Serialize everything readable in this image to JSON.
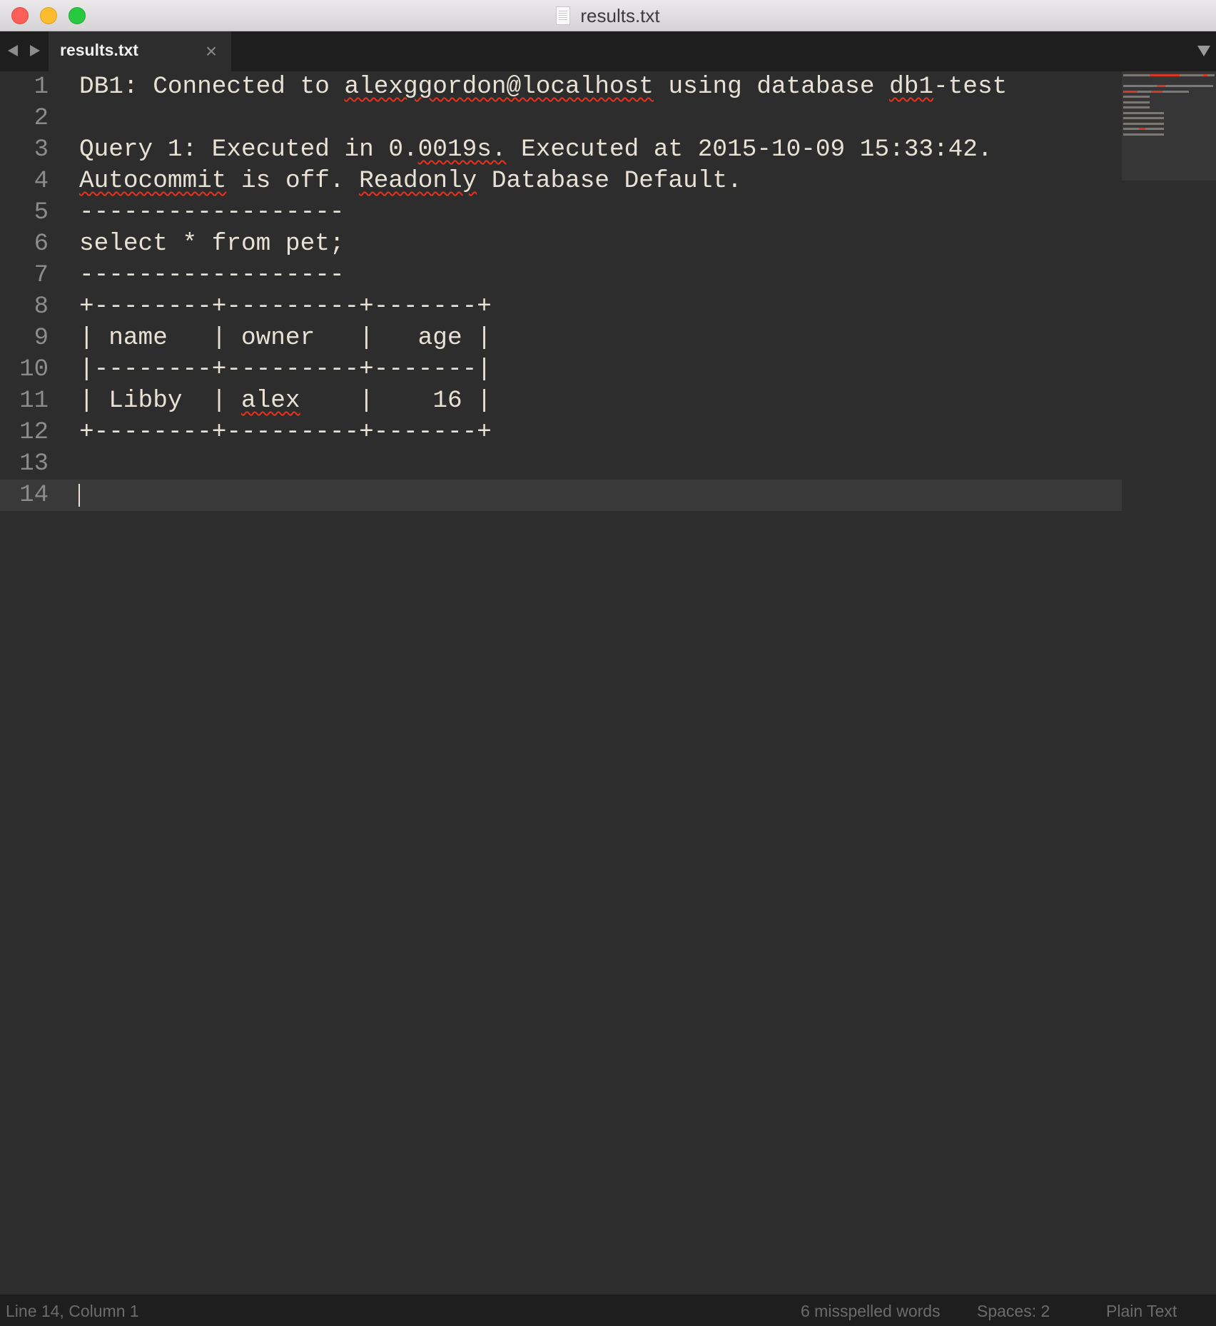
{
  "window": {
    "title": "results.txt",
    "title_icon": "document-icon"
  },
  "tabbar": {
    "back_icon": "triangle-left-icon",
    "forward_icon": "triangle-right-icon",
    "tabs": [
      {
        "label": "results.txt",
        "close_glyph": "×",
        "active": true
      }
    ],
    "dropdown_icon": "triangle-down-icon"
  },
  "editor": {
    "lines": [
      {
        "num": "1",
        "segments": [
          {
            "text": "DB1: Connected to ",
            "misspelled": false
          },
          {
            "text": "alexggordon@localhost",
            "misspelled": true
          },
          {
            "text": " using database ",
            "misspelled": false
          },
          {
            "text": "db1",
            "misspelled": true
          },
          {
            "text": "-test",
            "misspelled": false
          }
        ]
      },
      {
        "num": "2",
        "segments": []
      },
      {
        "num": "3",
        "segments": [
          {
            "text": "Query 1: Executed in 0.",
            "misspelled": false
          },
          {
            "text": "0019s.",
            "misspelled": true
          },
          {
            "text": " Executed at 2015-10-09 15:33:42.",
            "misspelled": false
          }
        ]
      },
      {
        "num": "4",
        "segments": [
          {
            "text": "Autocommit",
            "misspelled": true
          },
          {
            "text": " is off. ",
            "misspelled": false
          },
          {
            "text": "Readonly",
            "misspelled": true
          },
          {
            "text": " Database Default.",
            "misspelled": false
          }
        ]
      },
      {
        "num": "5",
        "segments": [
          {
            "text": "------------------",
            "misspelled": false
          }
        ]
      },
      {
        "num": "6",
        "segments": [
          {
            "text": "select * from pet;",
            "misspelled": false
          }
        ]
      },
      {
        "num": "7",
        "segments": [
          {
            "text": "------------------",
            "misspelled": false
          }
        ]
      },
      {
        "num": "8",
        "segments": [
          {
            "text": "+--------+---------+-------+",
            "misspelled": false
          }
        ]
      },
      {
        "num": "9",
        "segments": [
          {
            "text": "| name   | owner   |   age |",
            "misspelled": false
          }
        ]
      },
      {
        "num": "10",
        "segments": [
          {
            "text": "|--------+---------+-------|",
            "misspelled": false
          }
        ]
      },
      {
        "num": "11",
        "segments": [
          {
            "text": "| Libby  | ",
            "misspelled": false
          },
          {
            "text": "alex",
            "misspelled": true
          },
          {
            "text": "    |    16 |",
            "misspelled": false
          }
        ]
      },
      {
        "num": "12",
        "segments": [
          {
            "text": "+--------+---------+-------+",
            "misspelled": false
          }
        ]
      },
      {
        "num": "13",
        "segments": []
      },
      {
        "num": "14",
        "segments": [],
        "current": true
      }
    ],
    "query_result": {
      "columns": [
        "name",
        "owner",
        "age"
      ],
      "rows": [
        [
          "Libby",
          "alex",
          "16"
        ]
      ]
    }
  },
  "statusbar": {
    "position": "Line 14, Column 1",
    "spelling": "6 misspelled words",
    "indentation": "Spaces: 2",
    "syntax": "Plain Text"
  }
}
